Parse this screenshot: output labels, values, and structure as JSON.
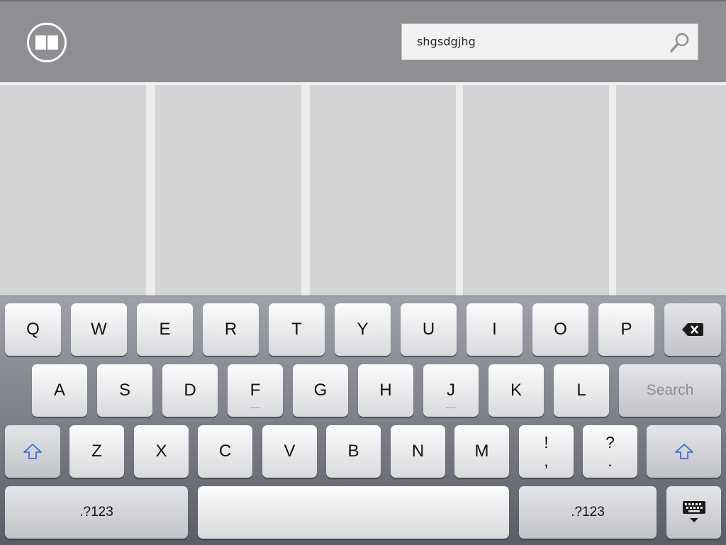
{
  "header": {
    "search_value": "shgsdgjhg"
  },
  "icons": {
    "logo": "book-icon",
    "search": "magnifier-icon",
    "backspace": "backspace-icon",
    "shift": "shift-arrow-icon",
    "hide_keyboard": "keyboard-hide-icon"
  },
  "keyboard": {
    "row1": [
      "Q",
      "W",
      "E",
      "R",
      "T",
      "Y",
      "U",
      "I",
      "O",
      "P"
    ],
    "row2": [
      "A",
      "S",
      "D",
      "F",
      "G",
      "H",
      "J",
      "K",
      "L"
    ],
    "search_label": "Search",
    "row3": [
      "Z",
      "X",
      "C",
      "V",
      "B",
      "N",
      "M"
    ],
    "punct1": [
      "!",
      ","
    ],
    "punct2": [
      "?",
      "."
    ],
    "numbers_label": ".?123"
  },
  "colors": {
    "header_bg": "#8e8f92",
    "panel_bg": "#d3d4d6",
    "shift_blue": "#3b6fd6"
  }
}
